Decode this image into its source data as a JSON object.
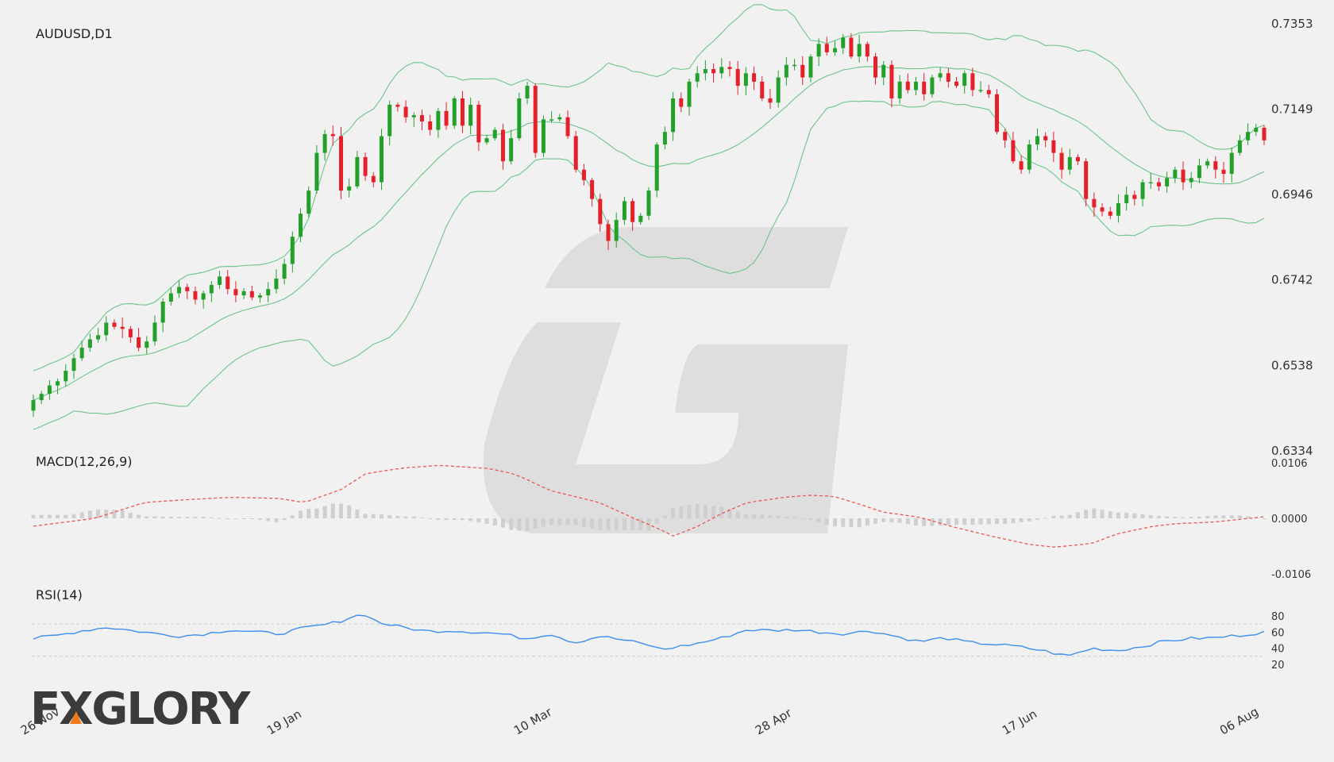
{
  "chart_data": [
    {
      "type": "candlestick",
      "title": "AUDUSD,D1",
      "y_ticks": [
        "0.7353",
        "0.7149",
        "0.6946",
        "0.6742",
        "0.6538",
        "0.6334"
      ],
      "ylim": [
        0.6334,
        0.7353
      ],
      "x_tick_labels": [
        "26 Nov",
        "19 Jan",
        "10 Mar",
        "28 Apr",
        "17 Jun",
        "06 Aug"
      ],
      "overlays": [
        "Bollinger Bands (upper, middle, lower)"
      ],
      "candles_close_approx": [
        0.6455,
        0.647,
        0.649,
        0.65,
        0.6525,
        0.6555,
        0.658,
        0.66,
        0.661,
        0.664,
        0.663,
        0.6625,
        0.6605,
        0.658,
        0.6595,
        0.664,
        0.669,
        0.671,
        0.6725,
        0.6715,
        0.6695,
        0.671,
        0.673,
        0.675,
        0.672,
        0.6705,
        0.6715,
        0.67,
        0.6705,
        0.672,
        0.6745,
        0.678,
        0.6845,
        0.69,
        0.6955,
        0.7045,
        0.709,
        0.7085,
        0.6955,
        0.6965,
        0.7035,
        0.699,
        0.6975,
        0.7085,
        0.716,
        0.7155,
        0.713,
        0.7135,
        0.712,
        0.71,
        0.7145,
        0.711,
        0.7175,
        0.711,
        0.716,
        0.707,
        0.708,
        0.71,
        0.7025,
        0.708,
        0.7175,
        0.7205,
        0.7045,
        0.7125,
        0.7125,
        0.713,
        0.7085,
        0.7005,
        0.698,
        0.6935,
        0.6875,
        0.6835,
        0.6885,
        0.693,
        0.688,
        0.6895,
        0.6955,
        0.7065,
        0.7095,
        0.7175,
        0.7155,
        0.7215,
        0.7235,
        0.7245,
        0.7235,
        0.725,
        0.7245,
        0.7205,
        0.7235,
        0.7215,
        0.7175,
        0.7165,
        0.7225,
        0.7255,
        0.7255,
        0.7225,
        0.7275,
        0.7305,
        0.7285,
        0.7295,
        0.732,
        0.7275,
        0.7305,
        0.7275,
        0.7225,
        0.7255,
        0.7175,
        0.7215,
        0.7195,
        0.7215,
        0.7185,
        0.7225,
        0.7235,
        0.7215,
        0.7205,
        0.7235,
        0.7195,
        0.7195,
        0.7185,
        0.7095,
        0.7075,
        0.7025,
        0.7005,
        0.7065,
        0.7085,
        0.7075,
        0.7045,
        0.7005,
        0.7035,
        0.7025,
        0.6935,
        0.6915,
        0.6905,
        0.6895,
        0.6925,
        0.6945,
        0.6935,
        0.6975,
        0.6975,
        0.6965,
        0.6985,
        0.7005,
        0.6975,
        0.6985,
        0.7015,
        0.7025,
        0.7005,
        0.6995,
        0.7045,
        0.7075,
        0.7095,
        0.7105,
        0.7075
      ]
    },
    {
      "type": "line",
      "title": "MACD(12,26,9)",
      "y_ticks": [
        "0.0106",
        "0.0000",
        "-0.0106"
      ],
      "ylim": [
        -0.0106,
        0.0106
      ],
      "series": [
        {
          "name": "Signal",
          "style": "dashed",
          "color": "#ef5350"
        },
        {
          "name": "Histogram",
          "type": "bar",
          "color": "#cfcfcf"
        }
      ],
      "signal_keypoints": [
        [
          0,
          -0.0015
        ],
        [
          0.05,
          0.0
        ],
        [
          0.09,
          0.003
        ],
        [
          0.12,
          0.0035
        ],
        [
          0.16,
          0.004
        ],
        [
          0.2,
          0.0038
        ],
        [
          0.22,
          0.003
        ],
        [
          0.25,
          0.0055
        ],
        [
          0.27,
          0.0085
        ],
        [
          0.3,
          0.0096
        ],
        [
          0.33,
          0.0101
        ],
        [
          0.37,
          0.0095
        ],
        [
          0.39,
          0.0085
        ],
        [
          0.4,
          0.0075
        ],
        [
          0.42,
          0.0053
        ],
        [
          0.46,
          0.003
        ],
        [
          0.49,
          -0.0002
        ],
        [
          0.51,
          -0.0022
        ],
        [
          0.52,
          -0.0034
        ],
        [
          0.54,
          -0.0015
        ],
        [
          0.56,
          0.001
        ],
        [
          0.58,
          0.003
        ],
        [
          0.61,
          0.004
        ],
        [
          0.63,
          0.0044
        ],
        [
          0.65,
          0.0042
        ],
        [
          0.67,
          0.0028
        ],
        [
          0.69,
          0.0012
        ],
        [
          0.72,
          0.0002
        ],
        [
          0.75,
          -0.0018
        ],
        [
          0.78,
          -0.0035
        ],
        [
          0.81,
          -0.005
        ],
        [
          0.83,
          -0.0055
        ],
        [
          0.86,
          -0.0048
        ],
        [
          0.88,
          -0.003
        ],
        [
          0.91,
          -0.0015
        ],
        [
          0.93,
          -0.001
        ],
        [
          0.96,
          -0.0007
        ],
        [
          1.0,
          0.0003
        ]
      ]
    },
    {
      "type": "line",
      "title": "RSI(14)",
      "y_ticks": [
        "80",
        "60",
        "40",
        "20"
      ],
      "ylim": [
        10,
        90
      ],
      "reference_lines": [
        70,
        30
      ],
      "series": [
        {
          "name": "RSI",
          "color": "#3d8ef0"
        }
      ],
      "rsi_keypoints": [
        [
          0,
          52
        ],
        [
          0.02,
          56
        ],
        [
          0.04,
          62
        ],
        [
          0.06,
          66
        ],
        [
          0.08,
          62
        ],
        [
          0.1,
          58
        ],
        [
          0.12,
          55
        ],
        [
          0.14,
          58
        ],
        [
          0.16,
          63
        ],
        [
          0.18,
          60
        ],
        [
          0.2,
          58
        ],
        [
          0.22,
          65
        ],
        [
          0.24,
          70
        ],
        [
          0.25,
          74
        ],
        [
          0.26,
          80
        ],
        [
          0.27,
          82
        ],
        [
          0.28,
          72
        ],
        [
          0.3,
          66
        ],
        [
          0.32,
          61
        ],
        [
          0.34,
          62
        ],
        [
          0.36,
          60
        ],
        [
          0.38,
          58
        ],
        [
          0.4,
          52
        ],
        [
          0.42,
          58
        ],
        [
          0.44,
          47
        ],
        [
          0.46,
          55
        ],
        [
          0.48,
          50
        ],
        [
          0.5,
          44
        ],
        [
          0.51,
          38
        ],
        [
          0.52,
          41
        ],
        [
          0.54,
          46
        ],
        [
          0.56,
          53
        ],
        [
          0.58,
          63
        ],
        [
          0.6,
          62
        ],
        [
          0.62,
          63
        ],
        [
          0.64,
          60
        ],
        [
          0.66,
          58
        ],
        [
          0.68,
          62
        ],
        [
          0.7,
          55
        ],
        [
          0.72,
          48
        ],
        [
          0.74,
          53
        ],
        [
          0.76,
          47
        ],
        [
          0.78,
          45
        ],
        [
          0.8,
          42
        ],
        [
          0.82,
          37
        ],
        [
          0.84,
          30
        ],
        [
          0.86,
          40
        ],
        [
          0.88,
          37
        ],
        [
          0.9,
          42
        ],
        [
          0.92,
          49
        ],
        [
          0.94,
          52
        ],
        [
          0.96,
          53
        ],
        [
          0.98,
          56
        ],
        [
          1.0,
          60
        ]
      ]
    }
  ],
  "logo": {
    "text": "FXGLORY",
    "colors": {
      "main": "#3b3b3b",
      "accent": "#f07a1a"
    }
  },
  "colors": {
    "bull": "#22a02a",
    "bear": "#e5202a",
    "bands": "#6bc58a",
    "grid_dash": "#cfcfcf"
  }
}
